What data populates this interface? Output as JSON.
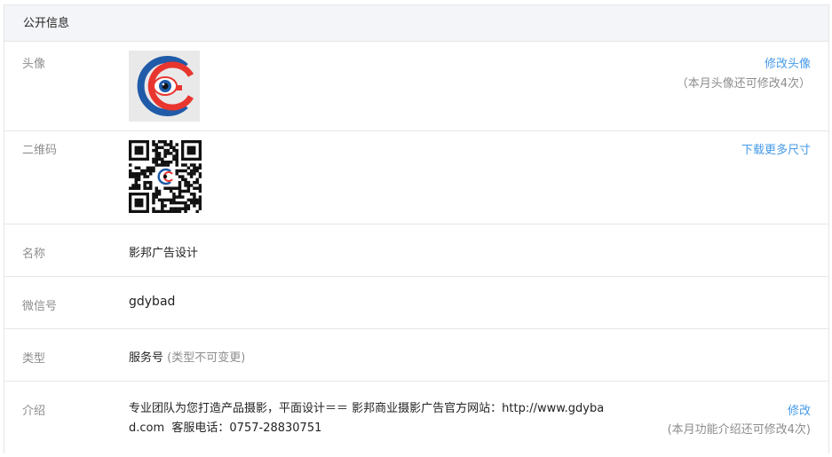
{
  "panel": {
    "title": "公开信息"
  },
  "rows": {
    "avatar": {
      "label": "头像",
      "action": "修改头像",
      "note": "（本月头像还可修改4次）"
    },
    "qrcode": {
      "label": "二维码",
      "action": "下载更多尺寸"
    },
    "name": {
      "label": "名称",
      "value": "影邦广告设计"
    },
    "wechat_id": {
      "label": "微信号",
      "value": "gdybad"
    },
    "type": {
      "label": "类型",
      "value": "服务号",
      "note": "(类型不可变更)"
    },
    "intro": {
      "label": "介绍",
      "line1": "专业团队为您打造产品摄影，平面设计＝＝ 影邦商业摄影广告官方网站：http://www.gdyba",
      "line2": "d.com  客服电话：0757-28830751",
      "action": "修改",
      "note": "(本月功能介绍还可修改4次)"
    }
  },
  "colors": {
    "link": "#459ae9",
    "muted": "#8d8d8d",
    "logo_red": "#e8362f",
    "logo_blue": "#1f5ba8"
  }
}
